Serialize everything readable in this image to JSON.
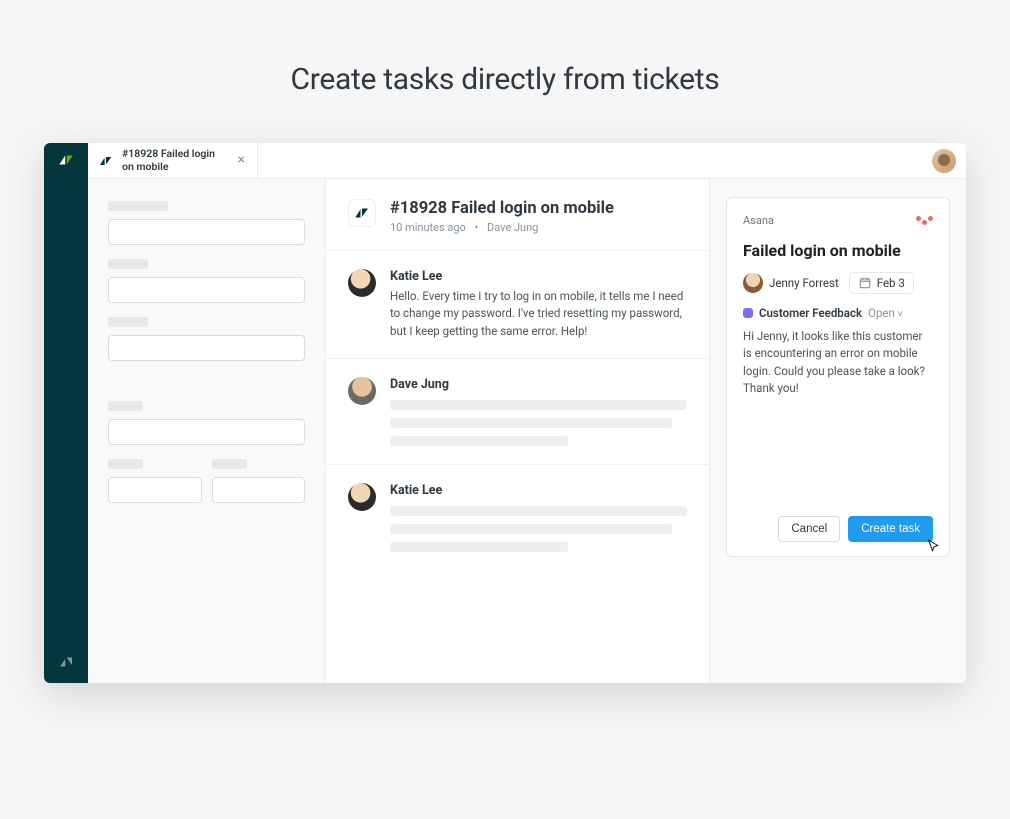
{
  "heading": "Create tasks directly from tickets",
  "tab": {
    "title": "#18928 Failed login on mobile",
    "close_glyph": "×"
  },
  "conversation": {
    "title": "#18928 Failed login on mobile",
    "timestamp": "10 minutes ago",
    "reporter": "Dave Jung",
    "messages": [
      {
        "author": "Katie Lee",
        "text": "Hello. Every time I try to log in on mobile, it tells me I need to change my password. I've tried resetting my password, but I keep getting the same error. Help!"
      },
      {
        "author": "Dave Jung",
        "text": ""
      },
      {
        "author": "Katie Lee",
        "text": ""
      }
    ]
  },
  "asana": {
    "app_label": "Asana",
    "task_title": "Failed login on mobile",
    "assignee": "Jenny Forrest",
    "due_date": "Feb 3",
    "project": "Customer Feedback",
    "status": "Open",
    "description": "Hi Jenny, it looks like this customer is encountering an error on mobile login. Could you please take a look? Thank you!",
    "cancel_label": "Cancel",
    "create_label": "Create task"
  }
}
